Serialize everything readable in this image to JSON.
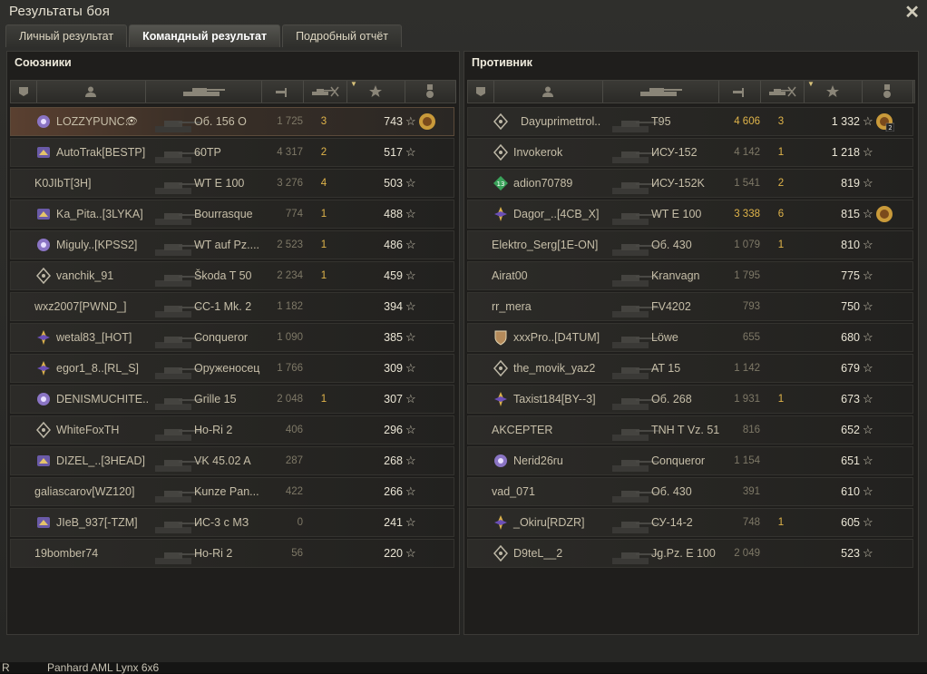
{
  "window": {
    "title": "Результаты боя",
    "close_label": "✕"
  },
  "tabs": [
    {
      "label": "Личный результат",
      "active": false
    },
    {
      "label": "Командный результат",
      "active": true
    },
    {
      "label": "Подробный отчёт",
      "active": false
    }
  ],
  "columns": [
    "platoon-icon",
    "player-icon",
    "tank-icon",
    "damage-icon",
    "kills-icon",
    "xp-star-icon",
    "medal-icon"
  ],
  "allies": {
    "title": "Союзники",
    "rows": [
      {
        "name": "LOZZYPUNC..",
        "badge": "rank-badge",
        "vehicle": "Об. 156 О",
        "damage": "1 725",
        "kills": "3",
        "xp": "743",
        "medal": true,
        "me": true,
        "hidden_eye": true
      },
      {
        "name": "AutoTrak[BESTP]",
        "badge": "clan-badge",
        "vehicle": "60TP",
        "damage": "4 317",
        "kills": "2",
        "xp": "517"
      },
      {
        "name": "K0JIbT[3H]",
        "badge": "",
        "vehicle": "WT E 100",
        "damage": "3 276",
        "kills": "4",
        "xp": "503"
      },
      {
        "name": "Ka_Pita..[3LYKA]",
        "badge": "clan-badge",
        "vehicle": "Bourrasque",
        "damage": "774",
        "kills": "1",
        "xp": "488"
      },
      {
        "name": "Miguly..[KPSS2]",
        "badge": "rank-badge",
        "vehicle": "WT auf Pz....",
        "damage": "2 523",
        "kills": "1",
        "xp": "486"
      },
      {
        "name": "vanchik_91",
        "badge": "diamond-badge",
        "vehicle": "Škoda T 50",
        "damage": "2 234",
        "kills": "1",
        "xp": "459"
      },
      {
        "name": "wxz2007[PWND_]",
        "badge": "",
        "vehicle": "CC-1 Mk. 2",
        "damage": "1 182",
        "kills": "",
        "xp": "394"
      },
      {
        "name": "wetal83_[HOT]",
        "badge": "purple-badge",
        "vehicle": "Conqueror",
        "damage": "1 090",
        "kills": "",
        "xp": "385"
      },
      {
        "name": "egor1_8..[RL_S]",
        "badge": "purple-badge",
        "vehicle": "Оруженосец",
        "damage": "1 766",
        "kills": "",
        "xp": "309"
      },
      {
        "name": "DENISMUCHITE..",
        "badge": "rank-badge",
        "vehicle": "Grille 15",
        "damage": "2 048",
        "kills": "1",
        "xp": "307"
      },
      {
        "name": "WhiteFoxTH",
        "badge": "diamond-badge",
        "vehicle": "Ho-Ri 2",
        "damage": "406",
        "kills": "",
        "xp": "296"
      },
      {
        "name": "DIZEL_..[3HEAD]",
        "badge": "clan-badge",
        "vehicle": "VK 45.02 A",
        "damage": "287",
        "kills": "",
        "xp": "268"
      },
      {
        "name": "galiascarov[WZ120]",
        "badge": "",
        "vehicle": "Kunze Pan...",
        "damage": "422",
        "kills": "",
        "xp": "266"
      },
      {
        "name": "JIeB_937[-TZM]",
        "badge": "clan-badge",
        "vehicle": "ИС-3 с МЗ",
        "damage": "0",
        "kills": "",
        "xp": "241"
      },
      {
        "name": "19bomber74",
        "badge": "",
        "vehicle": "Ho-Ri 2",
        "damage": "56",
        "kills": "",
        "xp": "220"
      }
    ]
  },
  "enemies": {
    "title": "Противник",
    "rows": [
      {
        "name": "Dayuprimettrol..",
        "badge": "diamond-badge",
        "vehicle": "T95",
        "damage": "4 606",
        "damage_hi": true,
        "kills": "3",
        "xp": "1 332",
        "medal": true,
        "medal_count": "2"
      },
      {
        "name": "Invokerok",
        "badge": "diamond-badge",
        "vehicle": "ИСУ-152",
        "damage": "4 142",
        "kills": "1",
        "xp": "1 218"
      },
      {
        "name": "adion70789",
        "badge": "green-badge",
        "vehicle": "ИСУ-152K",
        "damage": "1 541",
        "kills": "2",
        "xp": "819"
      },
      {
        "name": "Dagor_..[4CB_X]",
        "badge": "purple-badge",
        "vehicle": "WT E 100",
        "damage": "3 338",
        "damage_hi": true,
        "kills": "6",
        "xp": "815",
        "medal": true
      },
      {
        "name": "Elektro_Serg[1E-ON]",
        "badge": "",
        "vehicle": "Об. 430",
        "damage": "1 079",
        "kills": "1",
        "xp": "810"
      },
      {
        "name": "Airat00",
        "badge": "",
        "vehicle": "Kranvagn",
        "damage": "1 795",
        "kills": "",
        "xp": "775"
      },
      {
        "name": "rr_mera",
        "badge": "",
        "vehicle": "FV4202",
        "damage": "793",
        "kills": "",
        "xp": "750"
      },
      {
        "name": "xxxPro..[D4TUM]",
        "badge": "shield-badge",
        "vehicle": "Löwe",
        "damage": "655",
        "kills": "",
        "xp": "680"
      },
      {
        "name": "the_movik_yaz2",
        "badge": "diamond-badge",
        "vehicle": "AT 15",
        "damage": "1 142",
        "kills": "",
        "xp": "679"
      },
      {
        "name": "Taxist184[BY--3]",
        "badge": "purple-badge",
        "vehicle": "Об. 268",
        "damage": "1 931",
        "kills": "1",
        "xp": "673"
      },
      {
        "name": "AKCEPTER",
        "badge": "",
        "vehicle": "TNH T Vz. 51",
        "damage": "816",
        "kills": "",
        "xp": "652"
      },
      {
        "name": "Nerid26ru",
        "badge": "rank-badge",
        "vehicle": "Conqueror",
        "damage": "1 154",
        "kills": "",
        "xp": "651"
      },
      {
        "name": "vad_071",
        "badge": "",
        "vehicle": "Об. 430",
        "damage": "391",
        "kills": "",
        "xp": "610"
      },
      {
        "name": "_Okiru[RDZR]",
        "badge": "purple-badge",
        "vehicle": "СУ-14-2",
        "damage": "748",
        "kills": "1",
        "xp": "605"
      },
      {
        "name": "D9teL__2",
        "badge": "diamond-badge",
        "vehicle": "Jg.Pz. E 100",
        "damage": "2 049",
        "kills": "",
        "xp": "523"
      }
    ]
  },
  "bottom": {
    "left_text": "R",
    "text": "Panhard AML Lynx 6x6"
  }
}
